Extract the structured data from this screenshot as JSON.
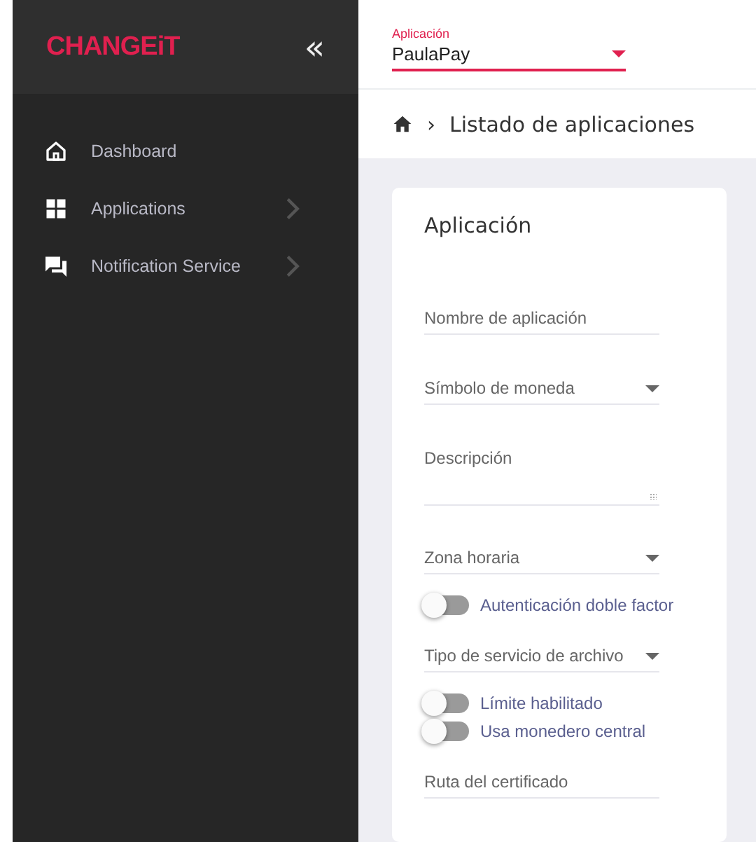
{
  "sidebar": {
    "logo": "CHANGEiT",
    "collapse": "«",
    "items": [
      {
        "label": "Dashboard",
        "has_children": false
      },
      {
        "label": "Applications",
        "has_children": true
      },
      {
        "label": "Notification Service",
        "has_children": true
      }
    ]
  },
  "app_selector": {
    "label": "Aplicación",
    "value": "PaulaPay"
  },
  "breadcrumb": {
    "separator": "›",
    "title": "Listado de aplicaciones"
  },
  "card": {
    "title": "Aplicación",
    "fields": [
      {
        "kind": "text",
        "placeholder": "Nombre de aplicación"
      },
      {
        "kind": "select",
        "placeholder": "Símbolo de moneda"
      },
      {
        "kind": "textarea",
        "placeholder": "Descripción"
      },
      {
        "kind": "select",
        "placeholder": "Zona horaria"
      },
      {
        "kind": "toggle",
        "label": "Autenticación doble factor",
        "on": false
      },
      {
        "kind": "select",
        "placeholder": "Tipo de servicio de archivo"
      },
      {
        "kind": "toggle",
        "label": "Límite habilitado",
        "on": false
      },
      {
        "kind": "toggle",
        "label": "Usa monedero central",
        "on": false
      },
      {
        "kind": "text",
        "placeholder": "Ruta del certificado"
      }
    ]
  }
}
